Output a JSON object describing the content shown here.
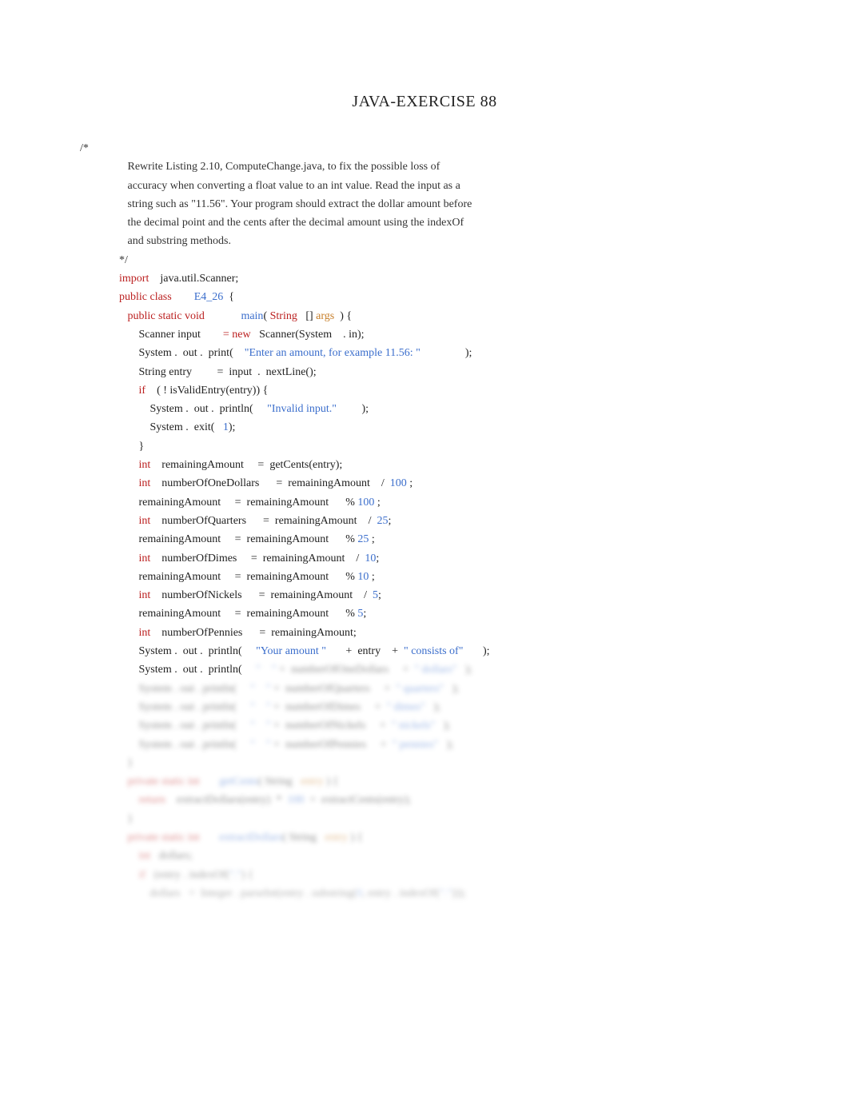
{
  "title": "JAVA-EXERCISE 88",
  "comment_open": "/*",
  "comment_lines": [
    "Rewrite Listing 2.10, ComputeChange.java, to fix the possible loss of",
    "accuracy when converting a float value to an int value. Read the input as a",
    "string such as \"11.56\". Your program should extract the dollar amount before",
    "the decimal point and the cents after the decimal amount using the indexOf",
    "and substring methods."
  ],
  "comment_close": "*/",
  "kw_import": "import",
  "import_target": "    java.util.Scanner;",
  "kw_public_class": "public class",
  "class_name": "E4_26",
  "brace_open": "  {",
  "kw_public_static_void": "public static void",
  "main_name": "main",
  "paren_open": "( ",
  "type_string": "String",
  "arr_brackets": "   [] ",
  "args_name": "args",
  "paren_close_brace": "  ) {",
  "line_scanner_a": "Scanner input        ",
  "kw_new": "= new",
  "line_scanner_b": "   Scanner(System    ",
  "dot": ". ",
  "in_token": "in);",
  "sys": "System ",
  "out": " out ",
  "print_call": " print(    ",
  "str_prompt": "\"Enter an amount, for example 11.56: \"",
  "spaces_end_paren": "                );",
  "line_entry": "String entry         =  input  .  nextLine();",
  "kw_if": "if",
  "if_cond": "    ( ! isValidEntry(entry)) {",
  "println_call": " println(     ",
  "str_invalid": "\"Invalid input.\"",
  "close_paren_semi": "         );",
  "exit_a": " exit(   ",
  "num_1": "1",
  "close_paren_semi2": ");",
  "brace_close": "}",
  "kw_int": "int",
  "line_ra_decl": "    remainingAmount     =  getCents(entry);",
  "line_dollars_a": "    numberOfOneDollars      =  remainingAmount    ",
  "slash": "/  ",
  "num_100": "100",
  "semi_space": " ;",
  "line_ra_assign": "remainingAmount     =  remainingAmount      ",
  "pct": "% ",
  "line_quarters_a": "    numberOfQuarters      =  remainingAmount    ",
  "num_25": "25",
  "semi": ";",
  "line_dimes_a": "    numberOfDimes     =  remainingAmount    ",
  "num_10": "10",
  "line_nickels_a": "    numberOfNickels      =  remainingAmount    ",
  "num_5": "5",
  "line_pennies": "    numberOfPennies      =  remainingAmount;",
  "str_your_amount": "\"Your amount \"",
  "plus": "       +  ",
  "entry_tok": "entry    ",
  "plus2": "+  ",
  "str_consists": "\" consists of\"",
  "end_paren_semi": "       );",
  "blur_row1_a": "\"    \"",
  "blur_row1_b": " +  numberOfOneDollars     +  ",
  "blur_row1_c": "\" dollars\"",
  "blur_row1_d": "   );",
  "blur_row2_a": "System . out . println(",
  "blur_row2_b": "\"    \"",
  "blur_row2_c": " +  numberOfQuarters     +  ",
  "blur_row2_d": "\" quarters\"",
  "blur_row2_e": "   );",
  "blur_row3_c": " +  numberOfDimes     +  ",
  "blur_row3_d": "\" dimes\"",
  "blur_row4_c": " +  numberOfNickels     +  ",
  "blur_row4_d": "\" nickels\"",
  "blur_row5_c": " +  numberOfPennies     +  ",
  "blur_row5_d": "\" pennies\"",
  "blur_method1_a": "private static int",
  "blur_method1_b": "getCents",
  "blur_method1_c": "( String",
  "blur_method1_d": "entry",
  "blur_method1_e": " ) {",
  "blur_method1_ret_a": "return",
  "blur_method1_ret_b": "    extractDollars(entry)  *  ",
  "blur_method1_ret_c": "100",
  "blur_method1_ret_d": "  +  extractCents(entry);",
  "blur_method2_a": "private static int",
  "blur_method2_b": "extractDollars",
  "blur_method2_c": "( String",
  "blur_method2_d": "entry",
  "blur_method2_e": " ) {",
  "blur_m2_l1_a": "int",
  "blur_m2_l1_b": "   dollars;",
  "blur_m2_l2_a": "if",
  "blur_m2_l2_b": "   (entry . indexOf(",
  "blur_m2_l2_c": "\".\"",
  "blur_m2_l2_d": ") {",
  "blur_m2_l3_a": "dollars",
  "blur_m2_l3_b": "   =  Integer . parseInt(entry",
  "blur_m2_l3_c": " . substring(",
  "blur_m2_l3_d": "0",
  "blur_m2_l3_e": ", entry . indexOf(",
  "blur_m2_l3_f": "\".\"",
  "blur_m2_l3_g": ")));"
}
